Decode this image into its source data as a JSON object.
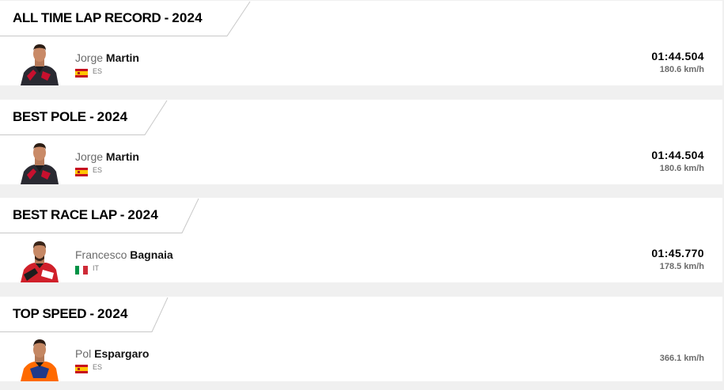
{
  "records": [
    {
      "title": "ALL TIME LAP RECORD",
      "year": "2024",
      "rider": {
        "first": "Jorge",
        "last": "Martin",
        "country": "ES",
        "flag": "spain-flag-icon"
      },
      "time": "01:44.504",
      "speed": "180.6 km/h"
    },
    {
      "title": "BEST POLE",
      "year": "2024",
      "rider": {
        "first": "Jorge",
        "last": "Martin",
        "country": "ES",
        "flag": "spain-flag-icon"
      },
      "time": "01:44.504",
      "speed": "180.6 km/h"
    },
    {
      "title": "BEST RACE LAP",
      "year": "2024",
      "rider": {
        "first": "Francesco",
        "last": "Bagnaia",
        "country": "IT",
        "flag": "italy-flag-icon"
      },
      "time": "01:45.770",
      "speed": "178.5 km/h"
    },
    {
      "title": "TOP SPEED",
      "year": "2024",
      "rider": {
        "first": "Pol",
        "last": "Espargaro",
        "country": "ES",
        "flag": "spain-flag-icon"
      },
      "speed": "366.1 km/h"
    }
  ],
  "colors": {
    "background": "#f0f0f0",
    "card": "#ffffff",
    "tab_border": "#c8c8c8",
    "spain_red": "#c60b1e",
    "spain_yellow": "#ffc400",
    "italy_green": "#009246",
    "italy_red": "#ce2b37"
  }
}
